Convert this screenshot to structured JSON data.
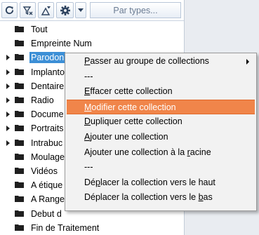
{
  "toolbar": {
    "filter_placeholder": "Par types...",
    "buttons": [
      {
        "icon": "refresh-icon"
      },
      {
        "icon": "filter-icon"
      },
      {
        "icon": "shapes-filter-icon"
      },
      {
        "icon": "gear-icon"
      },
      {
        "icon": "dropdown-arrow-icon"
      }
    ]
  },
  "tree": {
    "items": [
      {
        "label": "Tout",
        "expandable": false,
        "selected": false
      },
      {
        "label": "Empreinte Num",
        "expandable": false,
        "selected": false
      },
      {
        "label": "Parodon",
        "expandable": true,
        "selected": true
      },
      {
        "label": "Implanto",
        "expandable": true,
        "selected": false
      },
      {
        "label": "Dentaire",
        "expandable": true,
        "selected": false
      },
      {
        "label": "Radio",
        "expandable": true,
        "selected": false
      },
      {
        "label": "Docume",
        "expandable": true,
        "selected": false
      },
      {
        "label": "Portraits",
        "expandable": true,
        "selected": false
      },
      {
        "label": "Intrabuc",
        "expandable": true,
        "selected": false
      },
      {
        "label": "Moulage",
        "expandable": false,
        "selected": false
      },
      {
        "label": "Vidéos",
        "expandable": false,
        "selected": false
      },
      {
        "label": "A étique",
        "expandable": false,
        "selected": false
      },
      {
        "label": "A Range",
        "expandable": false,
        "selected": false
      },
      {
        "label": "Debut d",
        "expandable": false,
        "selected": false
      },
      {
        "label": "Fin de Traitement",
        "expandable": false,
        "selected": false
      }
    ]
  },
  "context_menu": {
    "items": [
      {
        "type": "item",
        "pre": "",
        "key": "P",
        "post": "asser au groupe de collections",
        "submenu": true,
        "highlight": false
      },
      {
        "type": "sep",
        "text": "---"
      },
      {
        "type": "item",
        "pre": "",
        "key": "E",
        "post": "ffacer cette collection",
        "submenu": false,
        "highlight": false
      },
      {
        "type": "item",
        "pre": "",
        "key": "M",
        "post": "odifier cette collection",
        "submenu": false,
        "highlight": true
      },
      {
        "type": "item",
        "pre": "",
        "key": "D",
        "post": "upliquer cette collection",
        "submenu": false,
        "highlight": false
      },
      {
        "type": "item",
        "pre": "",
        "key": "A",
        "post": "jouter une collection",
        "submenu": false,
        "highlight": false
      },
      {
        "type": "item",
        "pre": "Ajouter une collection à la ",
        "key": "r",
        "post": "acine",
        "submenu": false,
        "highlight": false
      },
      {
        "type": "sep",
        "text": "---"
      },
      {
        "type": "item",
        "pre": "Dé",
        "key": "p",
        "post": "lacer la collection vers le haut",
        "submenu": false,
        "highlight": false
      },
      {
        "type": "item",
        "pre": "Déplacer la collection vers le ",
        "key": "b",
        "post": "as",
        "submenu": false,
        "highlight": false
      }
    ]
  },
  "colors": {
    "selection": "#3c8fd6",
    "menu_highlight": "#f0854a",
    "menu_background": "#f2f2f2",
    "panel_background": "#e9ecf1"
  }
}
